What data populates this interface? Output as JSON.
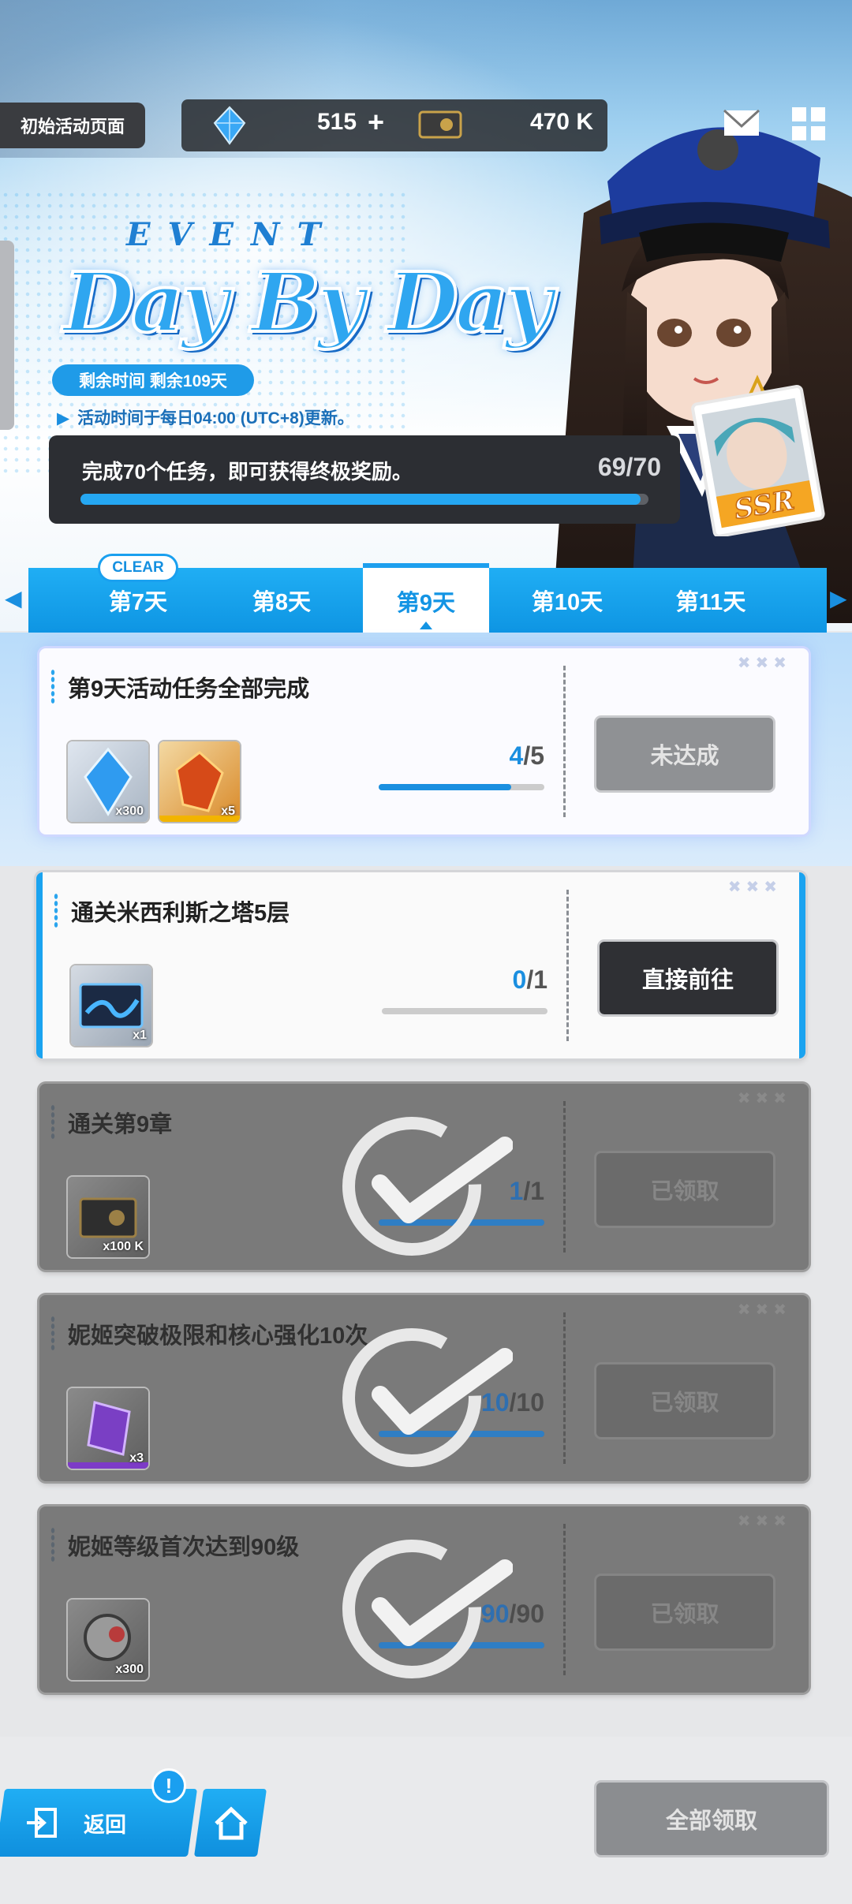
{
  "header": {
    "page_tag": "初始活动页面",
    "gem_count": "515",
    "gem_plus": "+",
    "credit_count": "470 K",
    "icons": [
      "gem-icon",
      "credit-icon",
      "mail-icon",
      "grid-menu-icon"
    ]
  },
  "event": {
    "event_word": "EVENT",
    "title": "Day By Day",
    "remaining": "剩余时间 剩余109天",
    "update_note": "活动时间于每日04:00 (UTC+8)更新。",
    "goal_text": "完成70个任务，即可获得终极奖励。",
    "goal_count": "69/70",
    "goal_progress": 0.9857,
    "reward_card": "SSR"
  },
  "tabs": {
    "clear_badge": "CLEAR",
    "days": [
      "第7天",
      "第8天",
      "第9天",
      "第10天",
      "第11天"
    ],
    "active_index": 2
  },
  "tasks": [
    {
      "title": "第9天活动任务全部完成",
      "items": [
        {
          "icon": "blue-gem-icon",
          "qty": "x300"
        },
        {
          "icon": "orange-gem-icon",
          "qty": "x5"
        }
      ],
      "current": "4",
      "total": "5",
      "progress": 0.8,
      "button": "未达成",
      "state": "unmet"
    },
    {
      "title": "通关米西利斯之塔5层",
      "items": [
        {
          "icon": "ticket-icon",
          "qty": "x1"
        }
      ],
      "current": "0",
      "total": "1",
      "progress": 0,
      "button": "直接前往",
      "state": "go"
    },
    {
      "title": "通关第9章",
      "items": [
        {
          "icon": "credit-case-icon",
          "qty": "x100 K"
        }
      ],
      "current": "1",
      "total": "1",
      "progress": 1,
      "button": "已领取",
      "state": "claimed"
    },
    {
      "title": "妮姬突破极限和核心强化10次",
      "items": [
        {
          "icon": "purple-crystal-icon",
          "qty": "x3"
        }
      ],
      "current": "10",
      "total": "10",
      "progress": 1,
      "button": "已领取",
      "state": "claimed"
    },
    {
      "title": "妮姬等级首次达到90级",
      "items": [
        {
          "icon": "core-dust-icon",
          "qty": "x300"
        }
      ],
      "current": "90",
      "total": "90",
      "progress": 1,
      "button": "已领取",
      "state": "claimed"
    }
  ],
  "footer": {
    "back_label": "返回",
    "alert": "!",
    "claim_all": "全部领取"
  },
  "colors": {
    "accent": "#1aa3f0",
    "dark_panel": "#2c2e33",
    "claimed_card": "#7a7a7a"
  }
}
